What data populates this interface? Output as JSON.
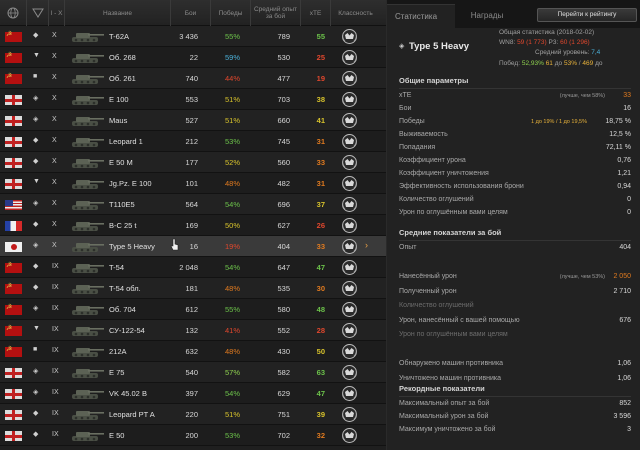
{
  "table": {
    "headers": {
      "nation": "",
      "type": "",
      "tier": "I - X",
      "name": "Название",
      "battles": "Бои",
      "wins": "Победы",
      "avg_exp": "Средний опыт за бой",
      "xte": "xTE",
      "mastery": "Классность"
    },
    "rows": [
      {
        "nation": "ussr",
        "type": "◆",
        "tier": "X",
        "name": "T-62A",
        "battles": "3 436",
        "wins": "55%",
        "win_color": "#6cc24a",
        "exp": "789",
        "xte": "55",
        "xte_color": "#6cc24a"
      },
      {
        "nation": "ussr",
        "type": "▼",
        "tier": "X",
        "name": "Об. 268",
        "battles": "22",
        "wins": "59%",
        "win_color": "#4bb0d8",
        "exp": "530",
        "xte": "25",
        "xte_color": "#e0472d"
      },
      {
        "nation": "ussr",
        "type": "■",
        "tier": "X",
        "name": "Об. 261",
        "battles": "740",
        "wins": "44%",
        "win_color": "#e0472d",
        "exp": "477",
        "xte": "19",
        "xte_color": "#e0472d"
      },
      {
        "nation": "germany",
        "type": "◈",
        "tier": "X",
        "name": "E 100",
        "battles": "553",
        "wins": "51%",
        "win_color": "#d8c32c",
        "exp": "703",
        "xte": "38",
        "xte_color": "#d8c32c"
      },
      {
        "nation": "germany",
        "type": "◈",
        "tier": "X",
        "name": "Maus",
        "battles": "527",
        "wins": "51%",
        "win_color": "#d8c32c",
        "exp": "660",
        "xte": "41",
        "xte_color": "#d8c32c"
      },
      {
        "nation": "germany",
        "type": "◆",
        "tier": "X",
        "name": "Leopard 1",
        "battles": "212",
        "wins": "53%",
        "win_color": "#6cc24a",
        "exp": "745",
        "xte": "31",
        "xte_color": "#e07a1f"
      },
      {
        "nation": "germany",
        "type": "◆",
        "tier": "X",
        "name": "E 50 M",
        "battles": "177",
        "wins": "52%",
        "win_color": "#d8c32c",
        "exp": "560",
        "xte": "33",
        "xte_color": "#e07a1f"
      },
      {
        "nation": "germany",
        "type": "▼",
        "tier": "X",
        "name": "Jg.Pz. E 100",
        "battles": "101",
        "wins": "48%",
        "win_color": "#e07a1f",
        "exp": "482",
        "xte": "31",
        "xte_color": "#e07a1f"
      },
      {
        "nation": "usa",
        "type": "◈",
        "tier": "X",
        "name": "T110E5",
        "battles": "564",
        "wins": "54%",
        "win_color": "#6cc24a",
        "exp": "696",
        "xte": "37",
        "xte_color": "#d8c32c"
      },
      {
        "nation": "france",
        "type": "◆",
        "tier": "X",
        "name": "B-C 25 t",
        "battles": "169",
        "wins": "50%",
        "win_color": "#d8c32c",
        "exp": "627",
        "xte": "26",
        "xte_color": "#e0472d"
      },
      {
        "nation": "japan",
        "type": "◈",
        "tier": "X",
        "name": "Type 5 Heavy",
        "battles": "16",
        "wins": "19%",
        "win_color": "#e0472d",
        "exp": "404",
        "xte": "33",
        "xte_color": "#e07a1f",
        "selected": true
      },
      {
        "nation": "ussr",
        "type": "◆",
        "tier": "IX",
        "name": "T-54",
        "battles": "2 048",
        "wins": "54%",
        "win_color": "#6cc24a",
        "exp": "647",
        "xte": "47",
        "xte_color": "#6cc24a"
      },
      {
        "nation": "ussr",
        "type": "◆",
        "tier": "IX",
        "name": "T-54 обл.",
        "battles": "181",
        "wins": "48%",
        "win_color": "#e07a1f",
        "exp": "535",
        "xte": "30",
        "xte_color": "#e07a1f"
      },
      {
        "nation": "ussr",
        "type": "◈",
        "tier": "IX",
        "name": "Об. 704",
        "battles": "612",
        "wins": "55%",
        "win_color": "#6cc24a",
        "exp": "580",
        "xte": "48",
        "xte_color": "#6cc24a"
      },
      {
        "nation": "ussr",
        "type": "▼",
        "tier": "IX",
        "name": "СУ-122-54",
        "battles": "132",
        "wins": "41%",
        "win_color": "#e0472d",
        "exp": "552",
        "xte": "28",
        "xte_color": "#e0472d"
      },
      {
        "nation": "ussr",
        "type": "■",
        "tier": "IX",
        "name": "212A",
        "battles": "632",
        "wins": "48%",
        "win_color": "#e07a1f",
        "exp": "430",
        "xte": "50",
        "xte_color": "#d8c32c"
      },
      {
        "nation": "germany",
        "type": "◈",
        "tier": "IX",
        "name": "E 75",
        "battles": "540",
        "wins": "57%",
        "win_color": "#8fd14f",
        "exp": "582",
        "xte": "63",
        "xte_color": "#6cc24a"
      },
      {
        "nation": "germany",
        "type": "◈",
        "tier": "IX",
        "name": "VK 45.02 B",
        "battles": "397",
        "wins": "54%",
        "win_color": "#6cc24a",
        "exp": "629",
        "xte": "47",
        "xte_color": "#6cc24a"
      },
      {
        "nation": "germany",
        "type": "◆",
        "tier": "IX",
        "name": "Leopard PT A",
        "battles": "220",
        "wins": "51%",
        "win_color": "#d8c32c",
        "exp": "751",
        "xte": "39",
        "xte_color": "#d8c32c"
      },
      {
        "nation": "germany",
        "type": "◆",
        "tier": "IX",
        "name": "E 50",
        "battles": "200",
        "wins": "53%",
        "win_color": "#6cc24a",
        "exp": "702",
        "xte": "32",
        "xte_color": "#e07a1f"
      }
    ]
  },
  "right": {
    "tabs": [
      "Статистика",
      "Награды"
    ],
    "rating_button": "Перейти к рейтингу",
    "vehicle_title": "Type 5 Heavy",
    "summary": {
      "date": "Общая статистика (2018-02-02)",
      "wn_label": "WN8:",
      "wn_value": "59 (1 773)",
      "r3_label": "Р3:",
      "r3_value": "60 (1 296)",
      "level_label": "Средний уровень:",
      "level_value": "7,4",
      "wins_label": "Побед:",
      "wins_pct": "52,93%",
      "wins_a": "61",
      "wins_a_suffix": "до",
      "wins_b": "53%",
      "wins_c": "469",
      "wins_c_suffix": "до"
    },
    "sections": {
      "general": "Общие параметры",
      "averages": "Средние показатели за бой",
      "records": "Рекордные показатели"
    },
    "general": [
      {
        "k": "xTE",
        "note": "(лучше, чем 58%)",
        "v": "33",
        "v_color": "#e07a1f"
      },
      {
        "k": "Бои",
        "v": "16"
      },
      {
        "k": "Победы",
        "note": "1 до 19% / 1 до 19,5%",
        "v": "18,75 %"
      },
      {
        "k": "Выживаемость",
        "v": "12,5 %"
      },
      {
        "k": "Попадания",
        "v": "72,11 %"
      },
      {
        "k": "Коэффициент урона",
        "v": "0,76"
      },
      {
        "k": "Коэффициент уничтожения",
        "v": "1,21"
      },
      {
        "k": "Эффективность использования брони",
        "v": "0,94"
      },
      {
        "k": "Количество оглушений",
        "v": "0"
      },
      {
        "k": "Урон по оглушённым вами целям",
        "v": "0"
      }
    ],
    "averages": [
      {
        "k": "Опыт",
        "v": "404"
      },
      {
        "k": "",
        "v": ""
      },
      {
        "k": "Нанесённый урон",
        "note": "(лучше, чем 53%)",
        "v": "2 050",
        "v_color": "#e07a1f"
      },
      {
        "k": "Полученный урон",
        "v": "2 710"
      },
      {
        "k": "Количество оглушений",
        "v": "",
        "dim": true
      },
      {
        "k": "Урон, нанесённый с вашей помощью",
        "v": "676"
      },
      {
        "k": "Урон по оглушённым вами целям",
        "v": "",
        "dim": true
      },
      {
        "k": "",
        "v": ""
      },
      {
        "k": "Обнаружено машин противника",
        "v": "1,06"
      },
      {
        "k": "Уничтожено машин противника",
        "v": "1,06"
      }
    ],
    "records": [
      {
        "k": "Максимальный опыт за бой",
        "v": "852"
      },
      {
        "k": "Максимальный урон за бой",
        "v": "3 596"
      },
      {
        "k": "Максимум уничтожено за бой",
        "v": "3"
      }
    ]
  }
}
